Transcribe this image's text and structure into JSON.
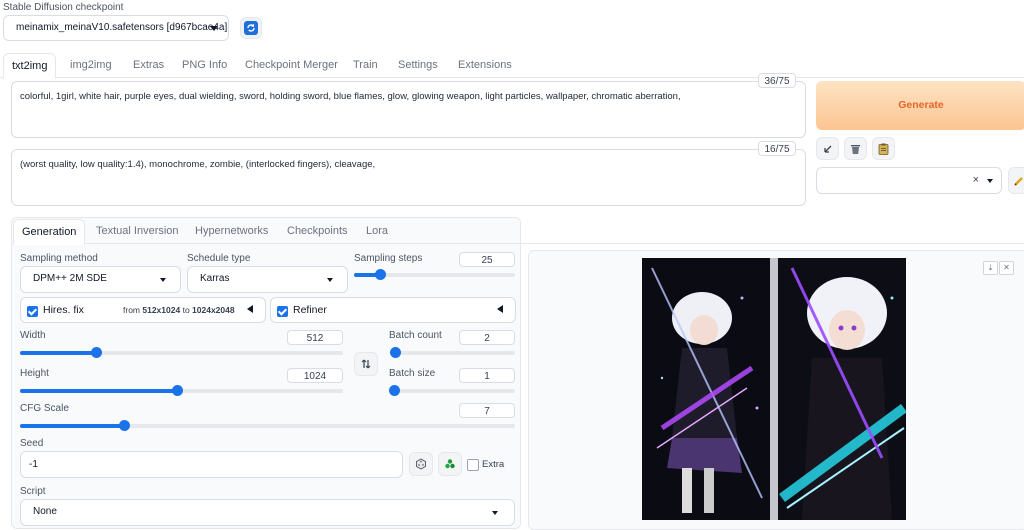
{
  "checkpoint": {
    "label": "Stable Diffusion checkpoint",
    "value": "meinamix_meinaV10.safetensors [d967bcae4a]"
  },
  "tabs": [
    "txt2img",
    "img2img",
    "Extras",
    "PNG Info",
    "Checkpoint Merger",
    "Train",
    "Settings",
    "Extensions"
  ],
  "prompt": {
    "text": "colorful, 1girl, white hair, purple eyes, dual wielding, sword, holding sword, blue flames, glow, glowing weapon, light particles, wallpaper, chromatic aberration,",
    "token_count": "36/75"
  },
  "negative_prompt": {
    "text": "(worst quality, low quality:1.4), monochrome, zombie, (interlocked fingers), cleavage,",
    "token_count": "16/75"
  },
  "generate_label": "Generate",
  "style_clear": "×",
  "subtabs": [
    "Generation",
    "Textual Inversion",
    "Hypernetworks",
    "Checkpoints",
    "Lora"
  ],
  "sampling_method": {
    "label": "Sampling method",
    "value": "DPM++ 2M SDE"
  },
  "schedule_type": {
    "label": "Schedule type",
    "value": "Karras"
  },
  "sampling_steps": {
    "label": "Sampling steps",
    "value": "25",
    "fraction": 0.16
  },
  "hires": {
    "label": "Hires. fix",
    "from_word": "from",
    "from_value": "512x1024",
    "to_word": "to",
    "to_value": "1024x2048"
  },
  "refiner": {
    "label": "Refiner"
  },
  "width": {
    "label": "Width",
    "value": "512",
    "fraction": 0.235
  },
  "height": {
    "label": "Height",
    "value": "1024",
    "fraction": 0.485
  },
  "batch_count": {
    "label": "Batch count",
    "value": "2",
    "fraction": 0.01
  },
  "batch_size": {
    "label": "Batch size",
    "value": "1",
    "fraction": 0.0
  },
  "cfg_scale": {
    "label": "CFG Scale",
    "value": "7",
    "fraction": 0.21
  },
  "seed": {
    "label": "Seed",
    "value": "-1",
    "extra_label": "Extra"
  },
  "script": {
    "label": "Script",
    "value": "None"
  },
  "colors": {
    "accent": "#1a73e8",
    "generate_start": "#fdd9b0",
    "generate_end": "#fcc08b",
    "generate_text": "#e4662a"
  }
}
